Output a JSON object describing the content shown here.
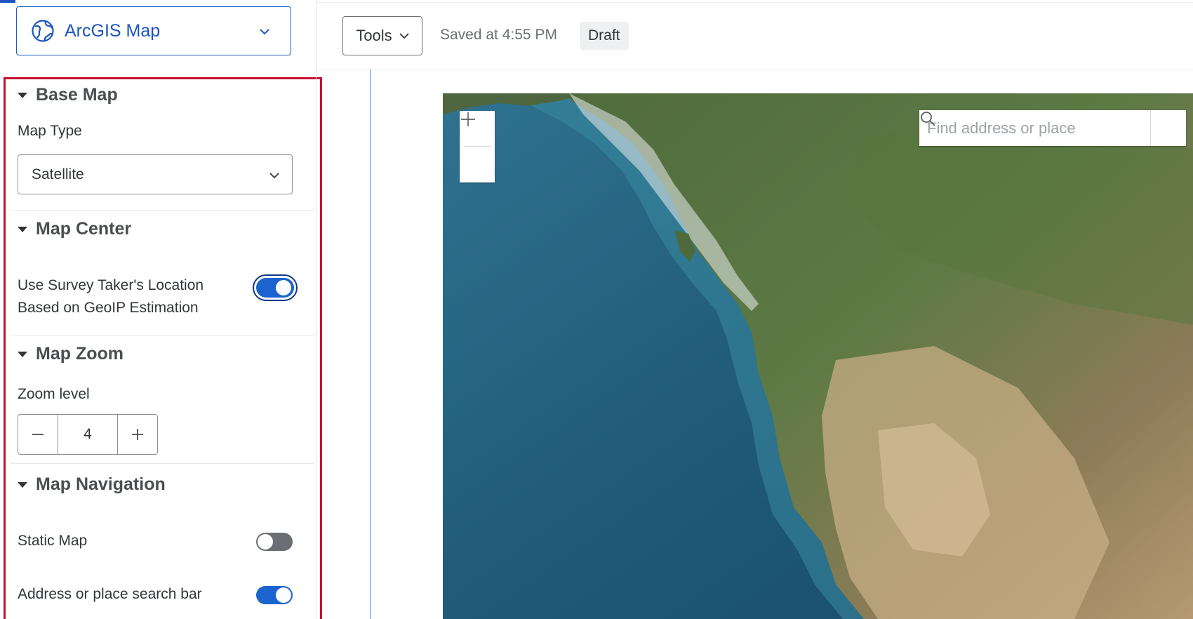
{
  "question_type": {
    "label": "ArcGIS Map",
    "icon": "globe-icon"
  },
  "sections": {
    "base_map": {
      "title": "Base Map",
      "map_type_label": "Map Type",
      "map_type_value": "Satellite"
    },
    "map_center": {
      "title": "Map Center",
      "geoip_label_line1": "Use Survey Taker's Location",
      "geoip_label_line2": "Based on GeoIP Estimation",
      "geoip_enabled": true
    },
    "map_zoom": {
      "title": "Map Zoom",
      "zoom_label": "Zoom level",
      "zoom_value": "4"
    },
    "map_navigation": {
      "title": "Map Navigation",
      "static_map_label": "Static Map",
      "static_map_enabled": false,
      "search_bar_label": "Address or place search bar",
      "search_bar_enabled": true
    }
  },
  "toolbar": {
    "tools_label": "Tools",
    "saved_status": "Saved at 4:55 PM",
    "draft_badge": "Draft"
  },
  "map_preview": {
    "search_placeholder": "Find address or place",
    "zoom_in_icon": "plus-icon",
    "zoom_out_icon": "minus-icon"
  },
  "colors": {
    "accent": "#1d63d0",
    "highlight_border": "#c8102e",
    "toggle_off": "#6b6f73"
  }
}
